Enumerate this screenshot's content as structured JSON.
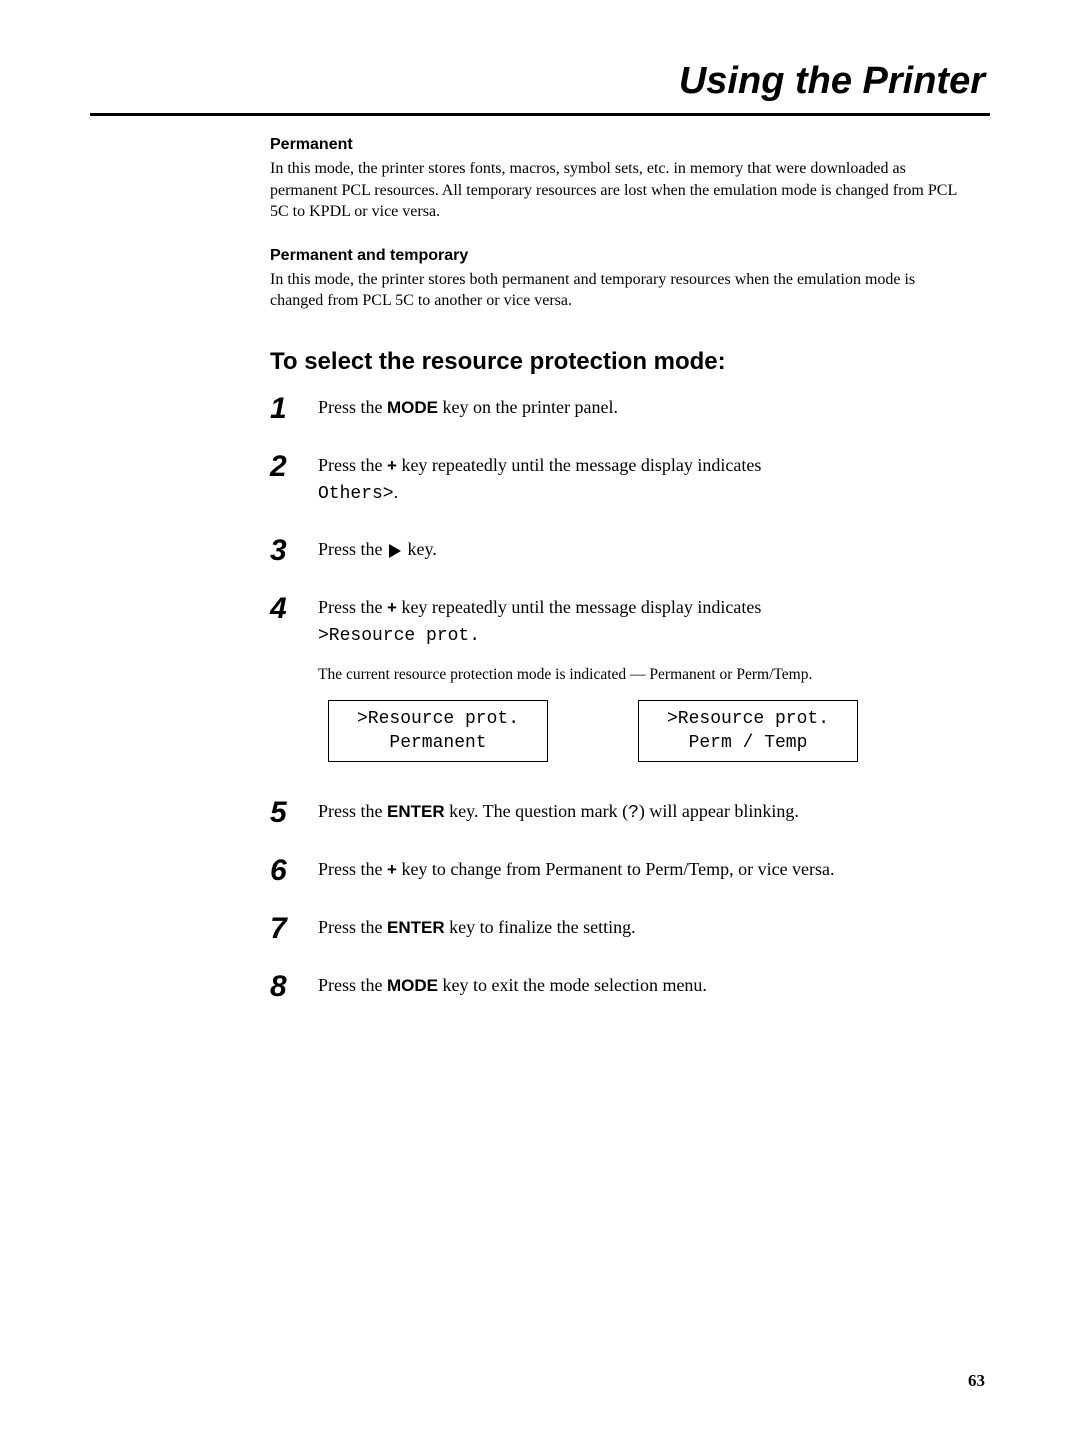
{
  "header": {
    "chapter_title": "Using the Printer"
  },
  "sections": {
    "permanent": {
      "heading": "Permanent",
      "body": "In this mode, the printer stores fonts, macros, symbol sets, etc. in memory that were downloaded as permanent PCL resources. All temporary resources are lost when the emulation mode is changed from PCL 5C to KPDL or vice versa."
    },
    "perm_temp": {
      "heading": "Permanent and temporary",
      "body": "In this mode, the printer stores both permanent and temporary resources when the emulation mode is changed from PCL 5C to another or vice versa."
    }
  },
  "procedure": {
    "title": "To select the resource protection mode:",
    "steps": {
      "s1": {
        "num": "1",
        "pre": "Press the ",
        "key": "MODE",
        "post": " key on the printer panel."
      },
      "s2": {
        "num": "2",
        "pre": "Press the ",
        "key": "+",
        "mid": " key repeatedly until the message display indicates ",
        "mono": "Others>",
        "post": "."
      },
      "s3": {
        "num": "3",
        "pre": "Press the ",
        "post": " key."
      },
      "s4": {
        "num": "4",
        "pre": "Press the ",
        "key": "+",
        "mid": " key repeatedly until the message display indicates ",
        "mono": ">Resource prot.",
        "note": "The current resource protection mode is indicated — Permanent or Perm/Temp.",
        "lcd1_line1": ">Resource prot.",
        "lcd1_line2": "Permanent",
        "lcd2_line1": ">Resource prot.",
        "lcd2_line2": "Perm / Temp"
      },
      "s5": {
        "num": "5",
        "pre": "Press the ",
        "key": "ENTER",
        "mid": " key. The question mark (",
        "mono": "?",
        "post": ") will appear blinking."
      },
      "s6": {
        "num": "6",
        "pre": "Press the ",
        "key": "+",
        "post": " key to change from Permanent to Perm/Temp, or vice versa."
      },
      "s7": {
        "num": "7",
        "pre": "Press the ",
        "key": "ENTER",
        "post": " key to finalize the setting."
      },
      "s8": {
        "num": "8",
        "pre": "Press the ",
        "key": "MODE",
        "post": " key to exit the mode selection menu."
      }
    }
  },
  "page_number": "63"
}
